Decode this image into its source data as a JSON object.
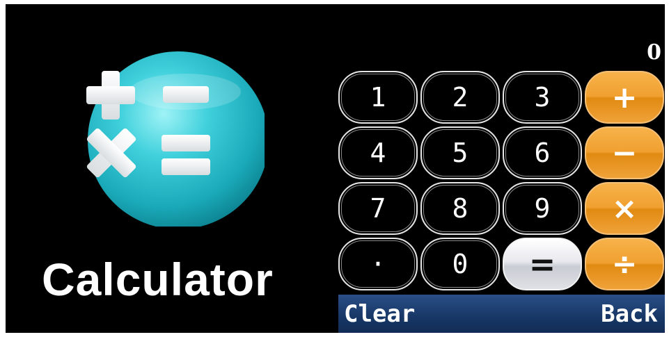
{
  "app": {
    "title": "Calculator"
  },
  "display": {
    "value": "0"
  },
  "keypad": {
    "keys": [
      {
        "label": "1",
        "kind": "num"
      },
      {
        "label": "2",
        "kind": "num"
      },
      {
        "label": "3",
        "kind": "num"
      },
      {
        "label": "+",
        "kind": "op"
      },
      {
        "label": "4",
        "kind": "num"
      },
      {
        "label": "5",
        "kind": "num"
      },
      {
        "label": "6",
        "kind": "num"
      },
      {
        "label": "−",
        "kind": "op"
      },
      {
        "label": "7",
        "kind": "num"
      },
      {
        "label": "8",
        "kind": "num"
      },
      {
        "label": "9",
        "kind": "num"
      },
      {
        "label": "×",
        "kind": "op"
      },
      {
        "label": "·",
        "kind": "num"
      },
      {
        "label": "0",
        "kind": "num"
      },
      {
        "label": "=",
        "kind": "eq"
      },
      {
        "label": "÷",
        "kind": "op"
      }
    ]
  },
  "bottom_bar": {
    "clear_label": "Clear",
    "back_label": "Back"
  },
  "colors": {
    "background": "#000000",
    "operator_orange": "#f0a030",
    "bar_blue": "#173766",
    "icon_cyan": "#27c2d2"
  },
  "icons": {
    "app_icon": "calculator-icon"
  }
}
